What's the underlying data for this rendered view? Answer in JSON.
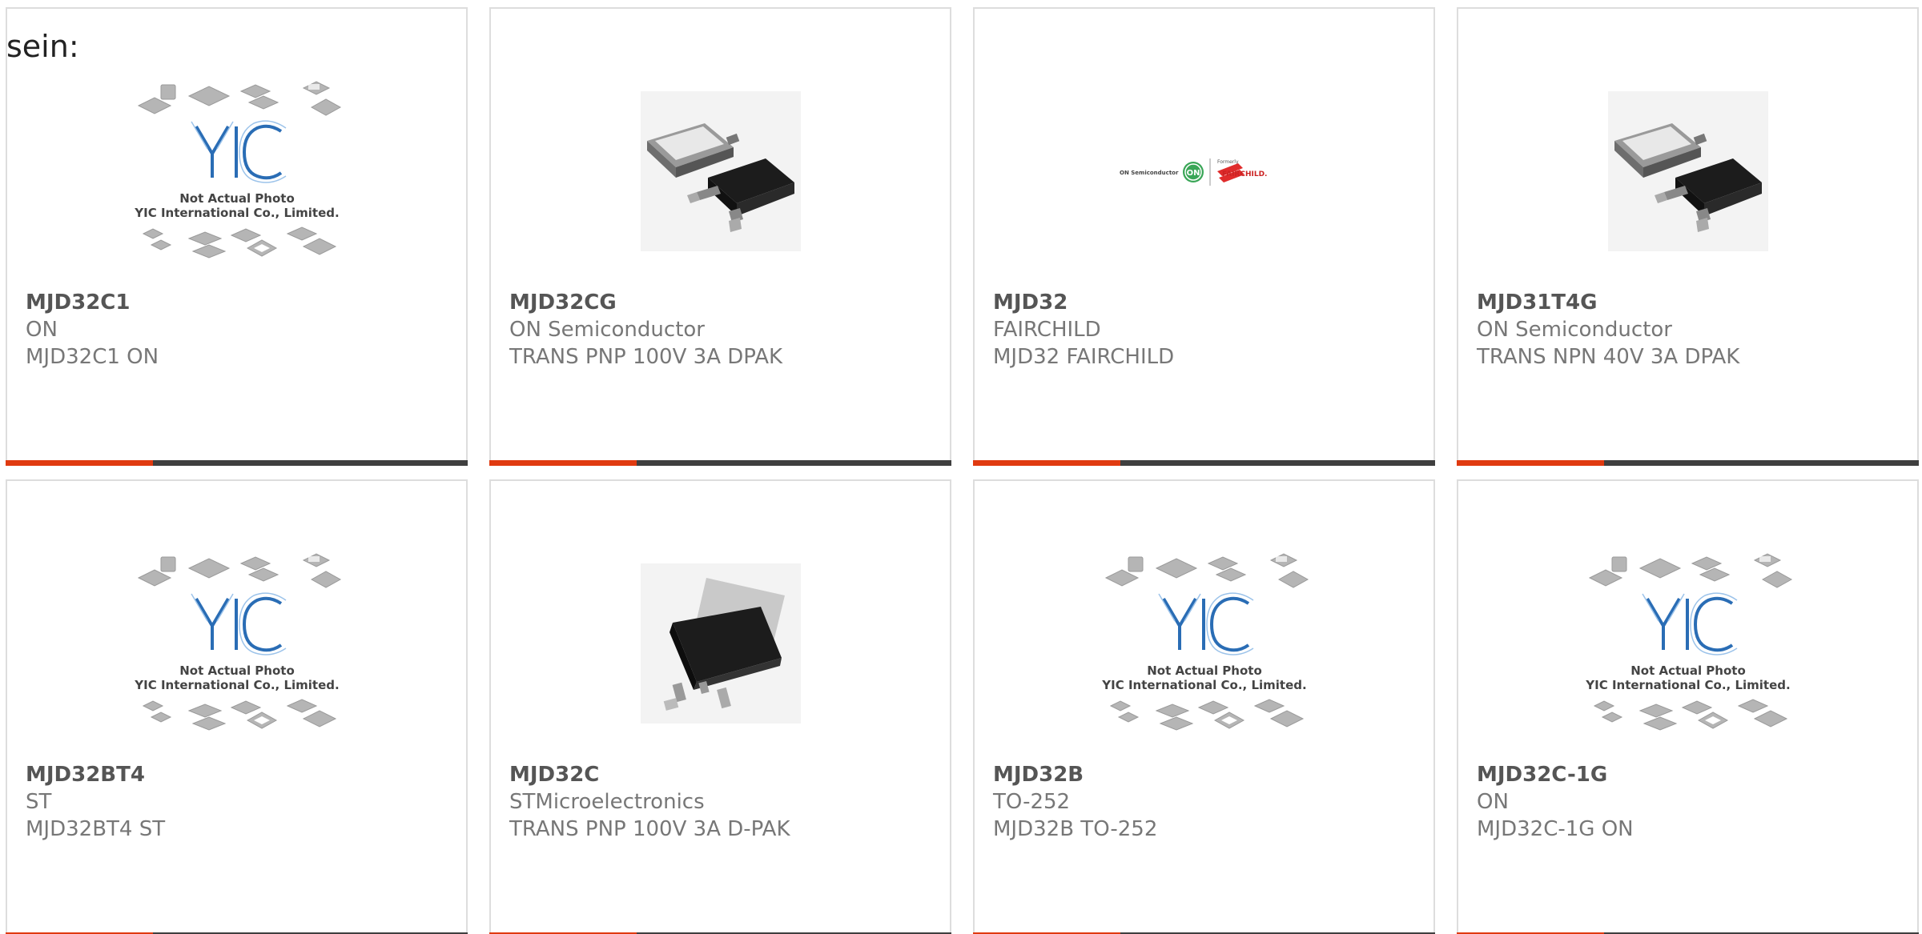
{
  "intro_text": "sein:",
  "placeholder": {
    "line1": "Not Actual Photo",
    "line2": "YIC International Co., Limited.",
    "logo": "YIC"
  },
  "brand_logo": {
    "left": "ON Semiconductor",
    "badge": "ON",
    "formerly": "Formerly",
    "right": "FAIRCHILD."
  },
  "colors": {
    "accent": "#e03a10",
    "bar": "#3f3f3f",
    "border": "#dddddd",
    "text": "#777777",
    "logo_blue": "#2a6db5"
  },
  "products": [
    {
      "part": "MJD32C1",
      "maker": "ON",
      "desc": "MJD32C1 ON",
      "image": "placeholder-photo"
    },
    {
      "part": "MJD32CG",
      "maker": "ON Semiconductor",
      "desc": "TRANS PNP 100V 3A DPAK",
      "image": "dpak-package"
    },
    {
      "part": "MJD32",
      "maker": "FAIRCHILD",
      "desc": "MJD32 FAIRCHILD",
      "image": "brand-logo"
    },
    {
      "part": "MJD31T4G",
      "maker": "ON Semiconductor",
      "desc": "TRANS NPN 40V 3A DPAK",
      "image": "dpak-package"
    },
    {
      "part": "MJD32BT4",
      "maker": "ST",
      "desc": "MJD32BT4 ST",
      "image": "placeholder-photo"
    },
    {
      "part": "MJD32C",
      "maker": "STMicroelectronics",
      "desc": "TRANS PNP 100V 3A D-PAK",
      "image": "dpak-package-rotated"
    },
    {
      "part": "MJD32B",
      "maker": "TO-252",
      "desc": "MJD32B TO-252",
      "image": "placeholder-photo"
    },
    {
      "part": "MJD32C-1G",
      "maker": "ON",
      "desc": "MJD32C-1G ON",
      "image": "placeholder-photo"
    }
  ]
}
